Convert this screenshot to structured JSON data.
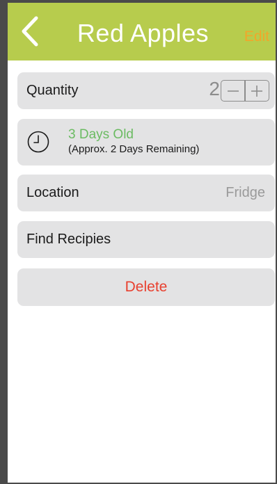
{
  "nav": {
    "title": "Red Apples",
    "edit_label": "Edit",
    "back_icon": "chevron-left-icon"
  },
  "quantity": {
    "label": "Quantity",
    "value": "2",
    "decrement_symbol": "−",
    "increment_symbol": "+"
  },
  "age": {
    "icon": "clock-icon",
    "title": "3 Days Old",
    "subtitle": "(Approx. 2 Days Remaining)"
  },
  "location": {
    "label": "Location",
    "value": "Fridge"
  },
  "recipes": {
    "label": "Find Recipies"
  },
  "delete": {
    "label": "Delete"
  },
  "colors": {
    "nav_bg": "#b7cc4d",
    "edit": "#f2a62a",
    "age_text": "#6bbb62",
    "delete_text": "#e8402f",
    "card_bg": "#e3e3e4"
  }
}
